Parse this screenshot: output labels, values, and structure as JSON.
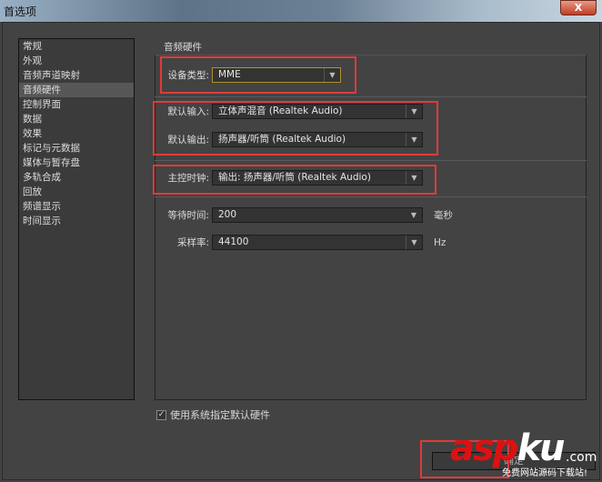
{
  "window": {
    "title": "首选项",
    "close_label": "X"
  },
  "sidebar": {
    "items": [
      "常规",
      "外观",
      "音频声道映射",
      "音频硬件",
      "控制界面",
      "数据",
      "效果",
      "标记与元数据",
      "媒体与暂存盘",
      "多轨合成",
      "回放",
      "频谱显示",
      "时间显示"
    ],
    "selected": 3
  },
  "panel": {
    "title": "音频硬件",
    "device_type": {
      "label": "设备类型:",
      "value": "MME"
    },
    "default_input": {
      "label": "默认输入:",
      "value": "立体声混音 (Realtek Audio)"
    },
    "default_output": {
      "label": "默认输出:",
      "value": "扬声器/听筒 (Realtek Audio)"
    },
    "master_clock": {
      "label": "主控时钟:",
      "value": "输出: 扬声器/听筒 (Realtek Audio)"
    },
    "latency": {
      "label": "等待时间:",
      "value": "200",
      "unit": "毫秒"
    },
    "sample_rate": {
      "label": "采样率:",
      "value": "44100",
      "unit": "Hz"
    },
    "use_system_default": {
      "label": "使用系统指定默认硬件",
      "checked": true
    }
  },
  "footer": {
    "button_label": "确定"
  },
  "watermark": {
    "brand_a": "asp",
    "brand_b": "ku",
    ".com": ".com",
    "slogan": "免费网站源码下载站!"
  }
}
